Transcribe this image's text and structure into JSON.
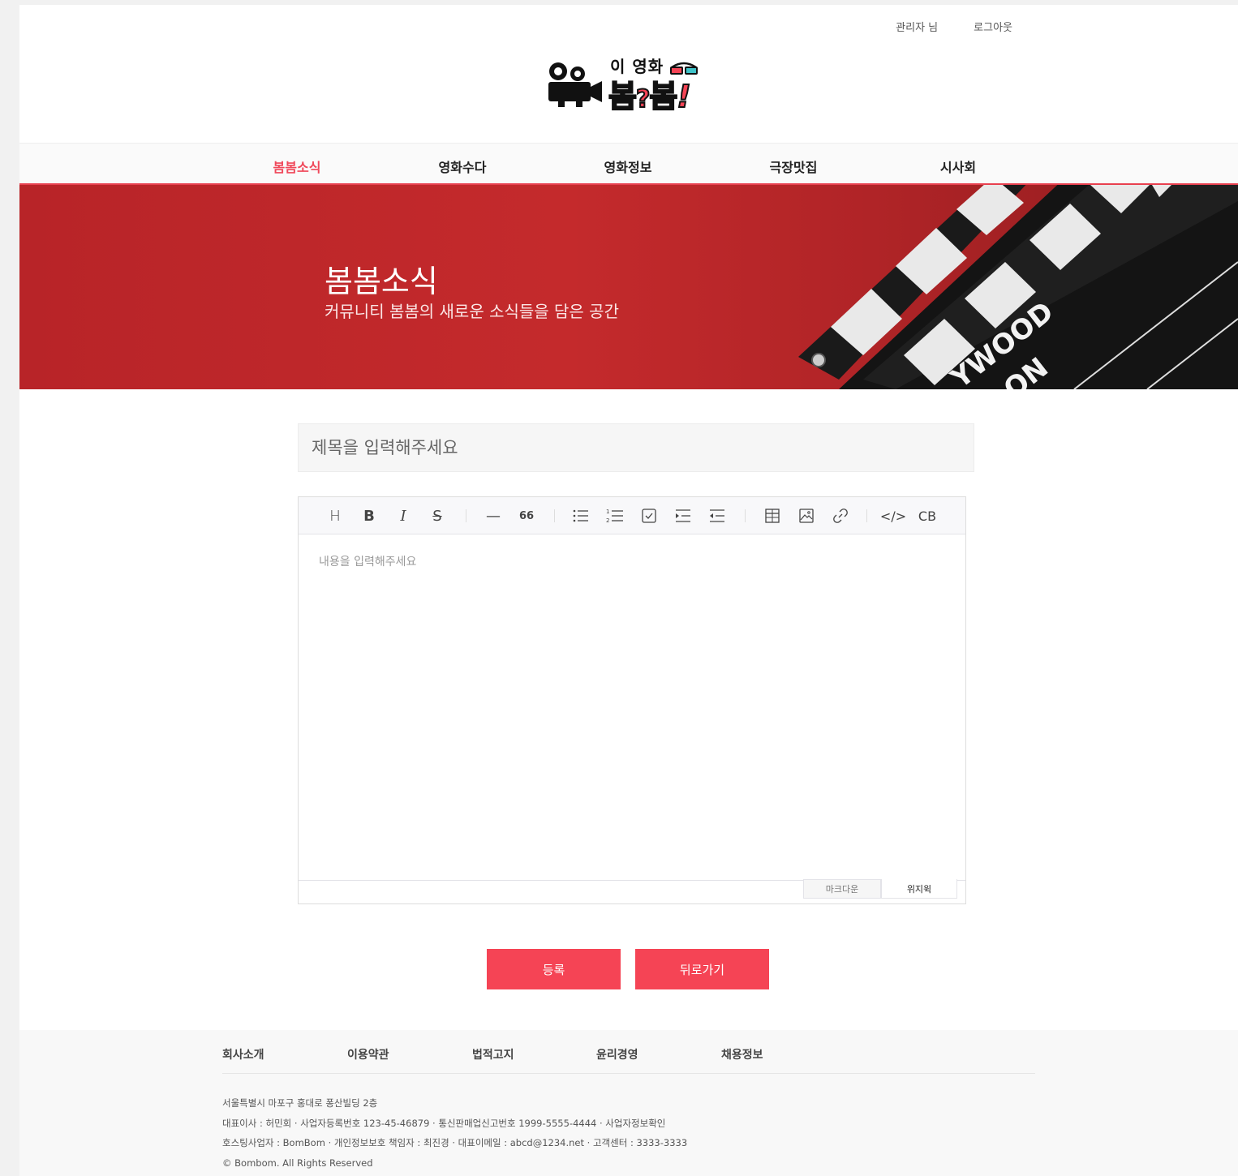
{
  "header": {
    "user_name": "관리자 님",
    "logout": "로그아웃",
    "logo": {
      "small_text": "이 영화",
      "big_text_1": "봄",
      "big_text_q": "?",
      "big_text_2": "봄",
      "big_text_excl": "!"
    }
  },
  "nav": {
    "items": [
      {
        "label": "봄봄소식",
        "active": true
      },
      {
        "label": "영화수다",
        "active": false
      },
      {
        "label": "영화정보",
        "active": false
      },
      {
        "label": "극장맛집",
        "active": false
      },
      {
        "label": "시사회",
        "active": false
      }
    ]
  },
  "banner": {
    "title": "봄봄소식",
    "subtitle": "커뮤니티 봄봄의 새로운 소식들을 담은 공간",
    "clapper_text_1": "YWOOD",
    "clapper_text_2": "ON"
  },
  "form": {
    "title_placeholder": "제목을 입력해주세요",
    "content_placeholder": "내용을 입력해주세요",
    "toolbar": {
      "heading": "H",
      "bold": "B",
      "italic": "I",
      "strike": "S",
      "hr": "—",
      "quote": "66",
      "code": "</>",
      "codeblock": "CB"
    },
    "mode_markdown": "마크다운",
    "mode_wysiwyg": "위지윅",
    "submit": "등록",
    "back": "뒤로가기"
  },
  "colors": {
    "accent": "#f54455",
    "banner": "#c42a2c",
    "nav_active": "#f0485a"
  },
  "footer": {
    "links": [
      "회사소개",
      "이용약관",
      "법적고지",
      "윤리경영",
      "채용정보"
    ],
    "address": "서울특별시 마포구 홍대로 퐁산빌딩 2층",
    "business": "대표이사 : 허민회 · 사업자등록번호 123-45-46879 · 통신판매업신고번호 1999-5555-4444 · 사업자정보확인",
    "hosting": "호스팅사업자 : BomBom · 개인정보보호 책임자 : 최진경 · 대표이메일 : abcd@1234.net · 고객센터 : 3333-3333",
    "copyright": "© Bombom. All Rights Reserved"
  }
}
